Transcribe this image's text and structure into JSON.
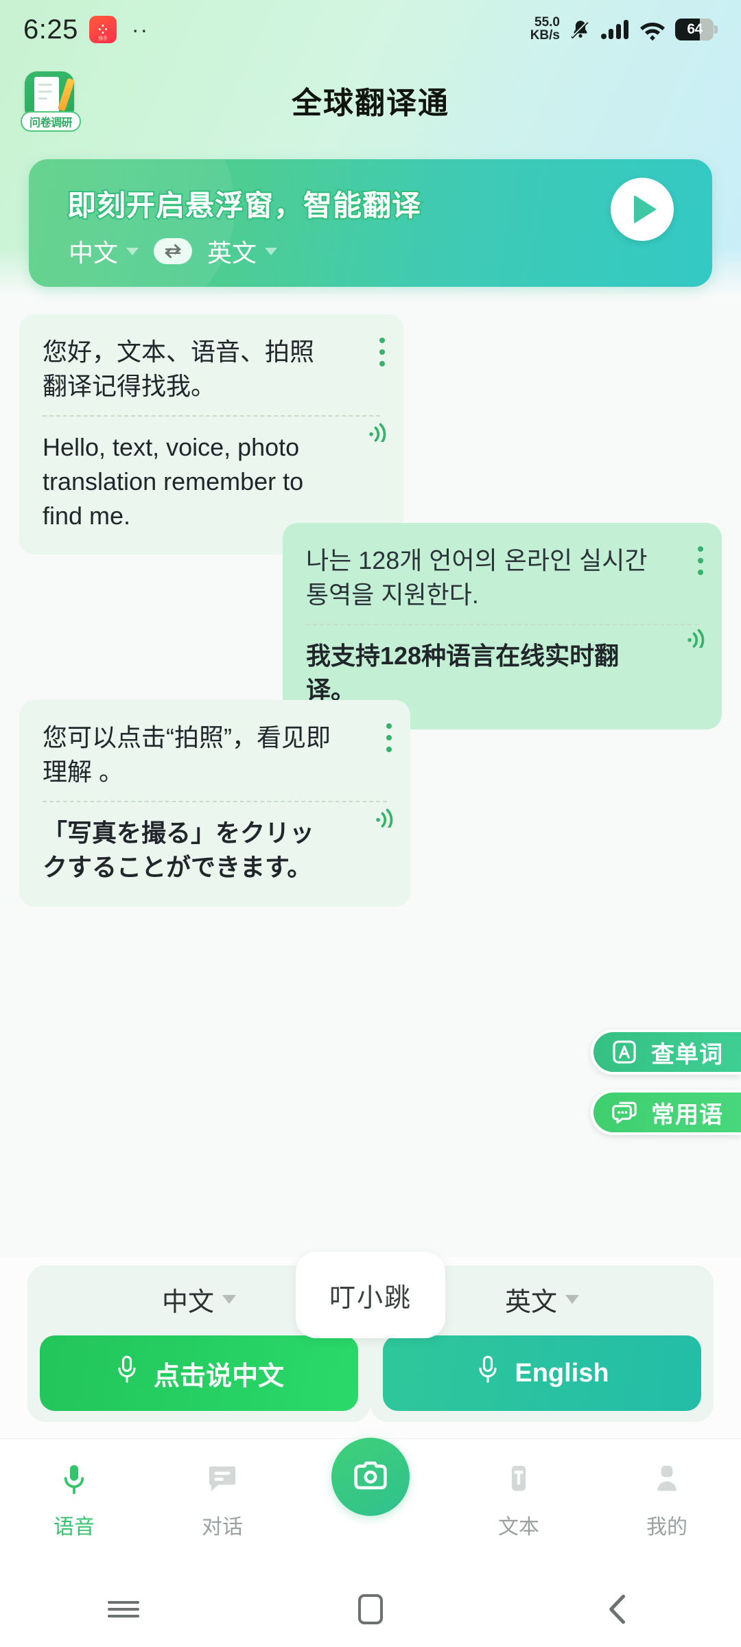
{
  "status_bar": {
    "time": "6:25",
    "app_icon_name": "kuaishou-app-icon",
    "app_icon_glyph": "⁘",
    "app_icon_sub": "快手",
    "overflow_dots": "··",
    "net_speed_value": "55.0",
    "net_speed_unit": "KB/s",
    "icons": [
      "mute-bell-icon",
      "signal-bars-icon",
      "wifi-icon"
    ],
    "battery_percent": "64"
  },
  "header": {
    "title": "全球翻译通",
    "survey_icon_name": "survey-clipboard-icon",
    "survey_badge_label": "问卷调研"
  },
  "banner": {
    "title": "即刻开启悬浮窗，智能翻译",
    "source_lang": "中文",
    "target_lang": "英文",
    "swap_icon": "⇄",
    "play_icon_name": "play-icon"
  },
  "chat": [
    {
      "side": "left",
      "source": "您好，文本、语音、拍照翻译记得找我。",
      "target": "Hello, text, voice, photo translation remember to find me.",
      "target_bold": false,
      "kebab_icon": "more-options-icon",
      "speaker_icon": "speaker-icon"
    },
    {
      "side": "right",
      "source": "나는 128개 언어의 온라인 실시간 통역을 지원한다.",
      "target": "我支持128种语言在线实时翻译。",
      "target_bold": true,
      "kebab_icon": "more-options-icon",
      "speaker_icon": "speaker-icon"
    },
    {
      "side": "left",
      "source": "您可以点击“拍照”，看见即理解 。",
      "target": "「写真を撮る」をクリックすることができます。",
      "target_bold": true,
      "kebab_icon": "more-options-icon",
      "speaker_icon": "speaker-icon"
    }
  ],
  "side_chips": [
    {
      "label": "查单词",
      "icon": "letter-a-box-icon"
    },
    {
      "label": "常用语",
      "icon": "chat-bubbles-icon"
    }
  ],
  "input_panel": {
    "left_lang": "中文",
    "right_lang": "英文",
    "left_button": "点击说中文",
    "right_button": "English",
    "mic_icon": "microphone-icon",
    "tooltip": "叮小跳"
  },
  "tab_bar": [
    {
      "label": "语音",
      "icon": "microphone-icon",
      "active": true
    },
    {
      "label": "对话",
      "icon": "chat-lines-icon",
      "active": false
    },
    {
      "label": "",
      "icon": "camera-icon",
      "active": false
    },
    {
      "label": "文本",
      "icon": "text-t-icon",
      "active": false
    },
    {
      "label": "我的",
      "icon": "person-icon",
      "active": false
    }
  ],
  "nav_bar": {
    "recents_icon": "menu-lines-icon",
    "home_icon": "home-square-icon",
    "back_icon": "back-chevron-icon"
  },
  "colors": {
    "accent_green": "#35c46d",
    "bubble_left": "#eaf6ee",
    "bubble_right": "#c3efd4",
    "page_bg": "#f8faf9"
  }
}
